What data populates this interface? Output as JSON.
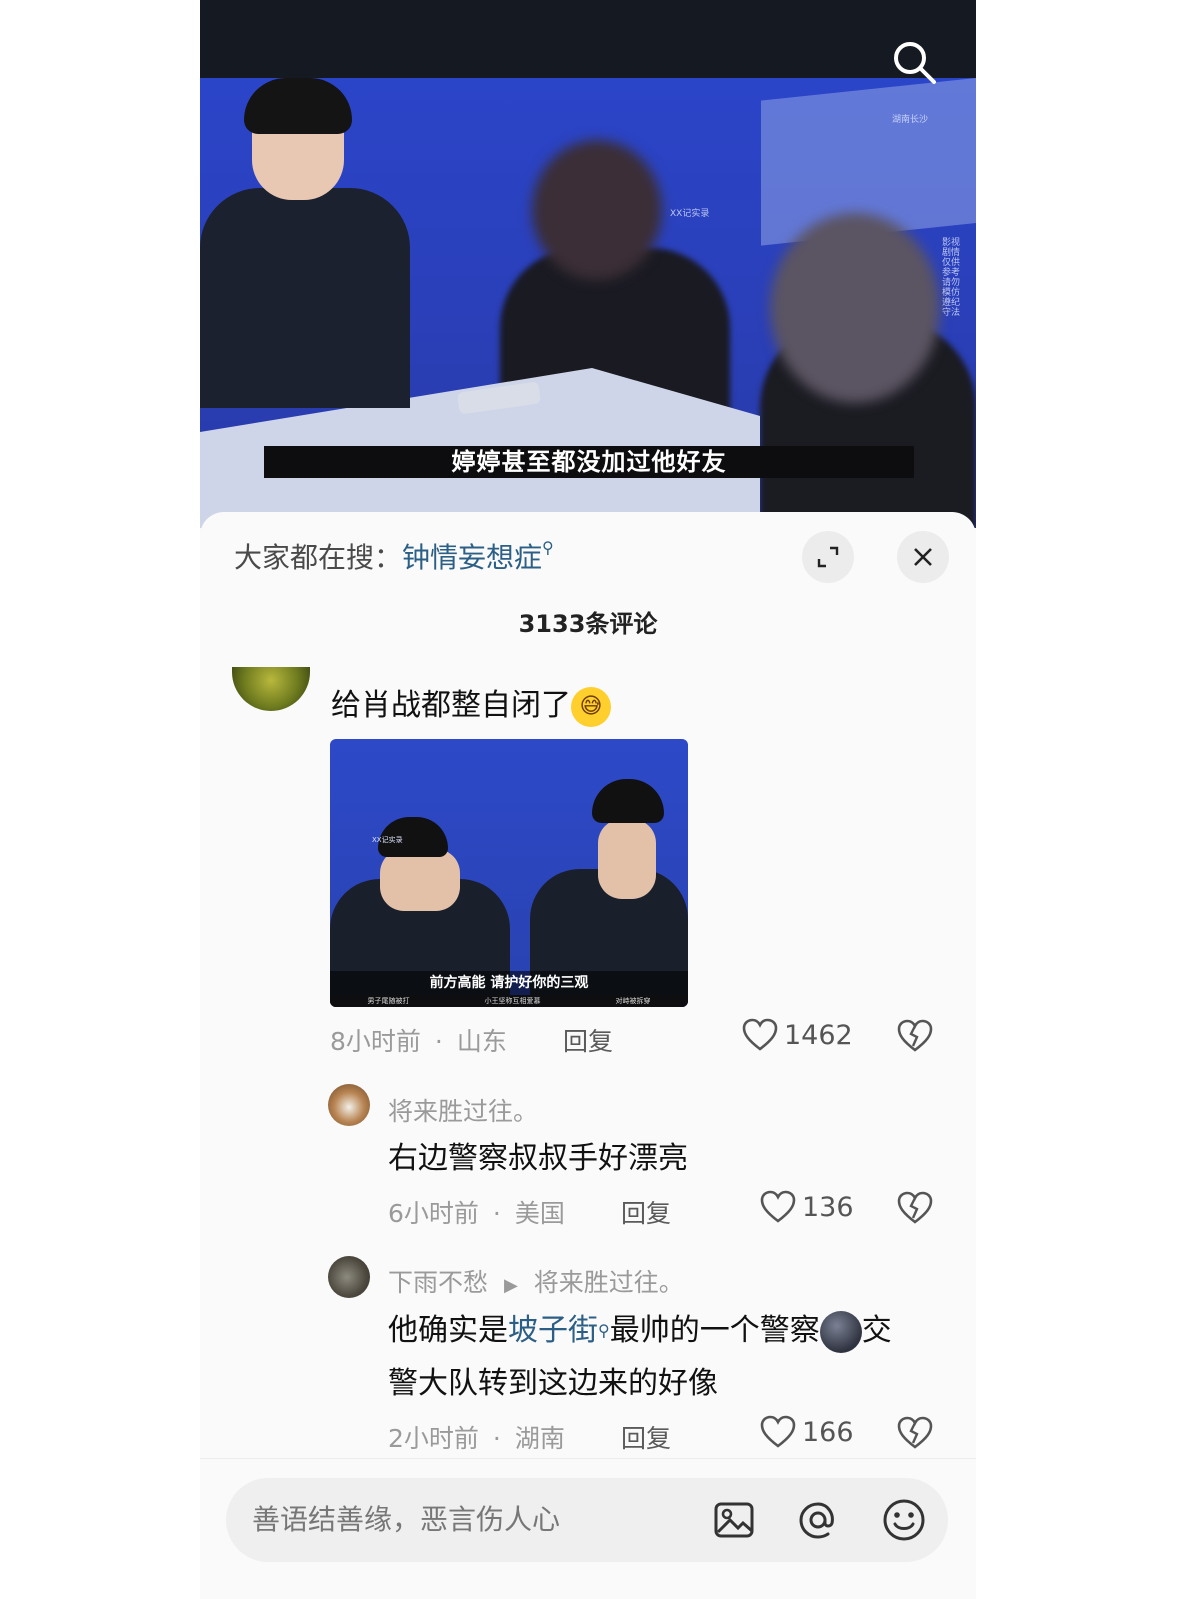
{
  "video": {
    "subtitle": "婷婷甚至都没加过他好友",
    "watermark_tag": "XX记实录",
    "watermark_corner": "湖南长沙",
    "watermark_side": "影视剧情 仅供参考 请勿模仿 遵纪守法"
  },
  "comments_panel": {
    "hot_search_label": "大家都在搜：",
    "hot_search_keyword": "钟情妄想症",
    "comment_count": "3133条评论",
    "comments": [
      {
        "text": "给肖战都整自闭了",
        "emoji": "😅",
        "image_caption": "前方高能 请护好你的三观",
        "image_tabs": [
          "男子尾随被打",
          "小王坚称互相爱慕",
          "对峙被拆穿"
        ],
        "image_tag": "XX记实录",
        "time": "8小时前",
        "location": "山东",
        "reply_label": "回复",
        "likes": "1462"
      }
    ],
    "replies": [
      {
        "user": "将来胜过往。",
        "text": "右边警察叔叔手好漂亮",
        "time": "6小时前",
        "location": "美国",
        "reply_label": "回复",
        "likes": "136"
      },
      {
        "user": "下雨不愁",
        "reply_to": "将来胜过往。",
        "text_before": "他确实是",
        "text_link": "坡子街",
        "text_after_line1": "最帅的一个警察",
        "text_after_line1_end": "交",
        "text_line2": "警大队转到这边来的好像",
        "time": "2小时前",
        "location": "湖南",
        "reply_label": "回复",
        "likes": "166"
      }
    ]
  },
  "input": {
    "placeholder": "善语结善缘，恶言伤人心"
  },
  "icons": {
    "search": "search-icon",
    "expand": "expand-icon",
    "close": "close-icon",
    "like": "heart-icon",
    "dislike": "broken-heart-icon",
    "image": "image-icon",
    "mention": "at-icon",
    "emoji": "smiley-icon"
  },
  "colors": {
    "link": "#2c5f86",
    "muted": "#9a9a9a",
    "video_blue": "#2b45c9"
  }
}
